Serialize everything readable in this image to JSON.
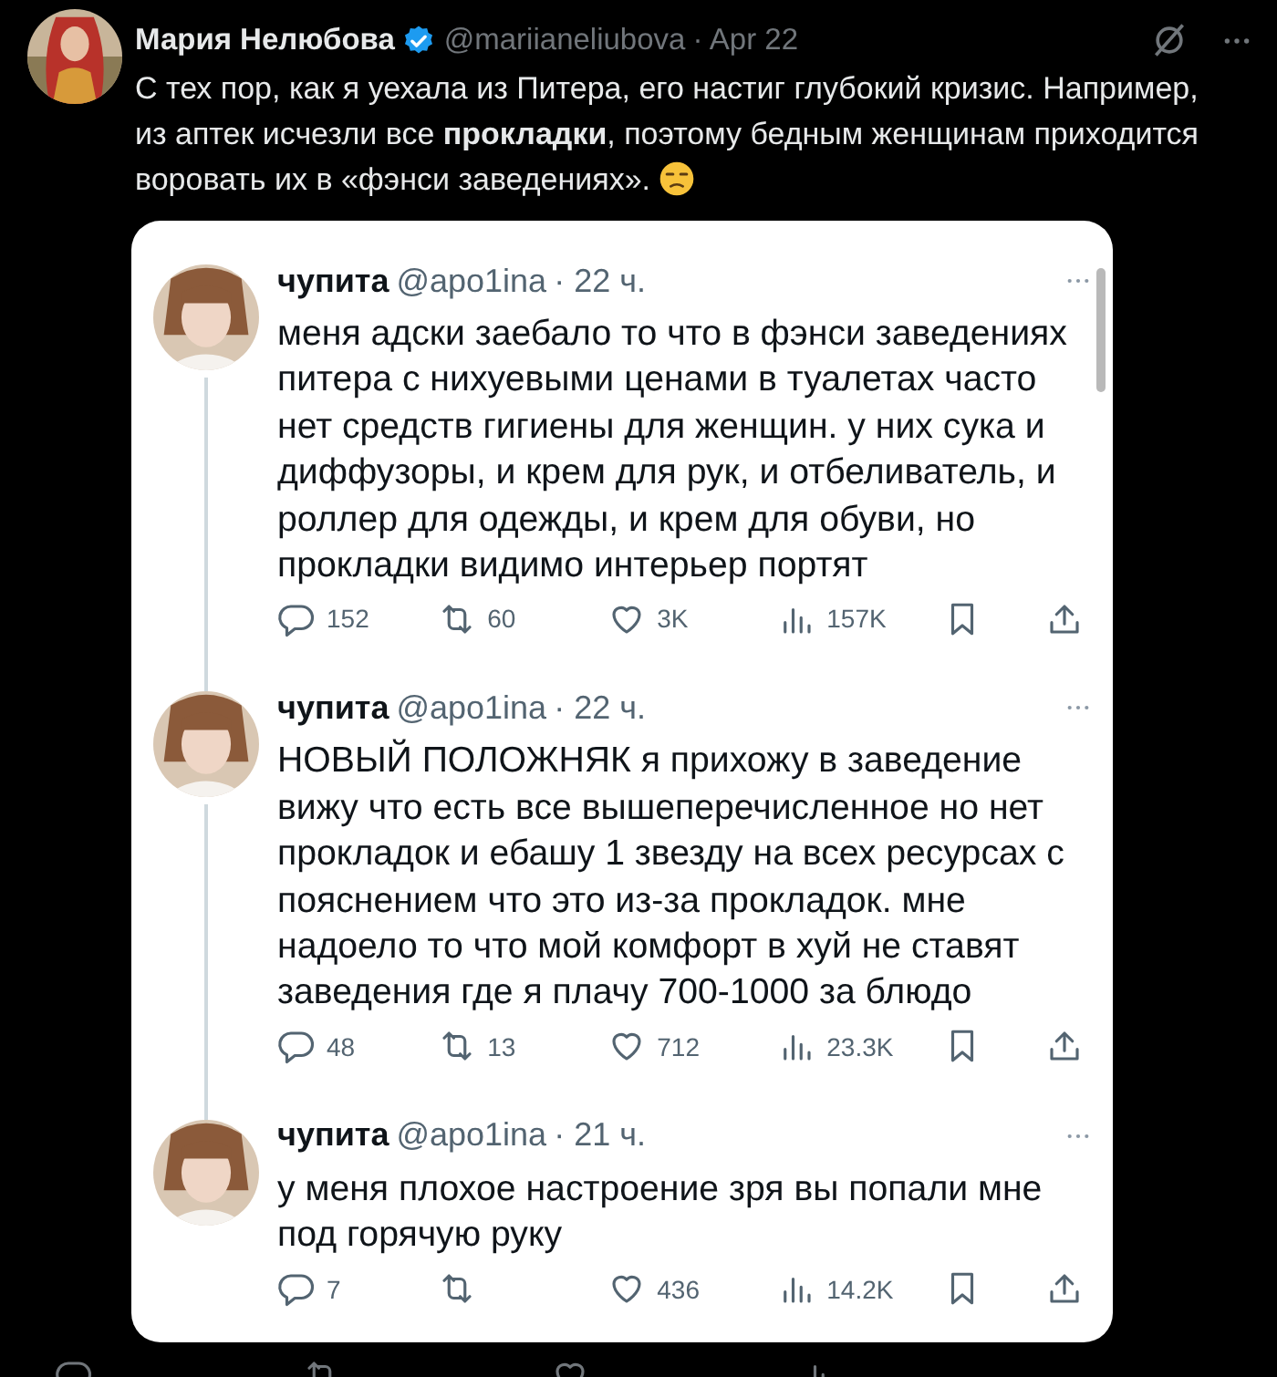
{
  "tweet": {
    "name": "Мария Нелюбова",
    "verified": true,
    "handle": "@mariianeliubova",
    "date": "· Apr 22",
    "text": "С тех пор, как я уехала из Питера, его настиг глубокий кризис. Например, из аптек исчезли все **прокладки**, поэтому бедным женщинам приходится воровать их в «фэнси заведениях».",
    "actions": [
      {
        "kind": "reply"
      },
      {
        "kind": "repost"
      },
      {
        "kind": "like"
      },
      {
        "kind": "views"
      }
    ]
  },
  "quoted_thread": [
    {
      "name": "чупита",
      "handle": "@apo1ina",
      "time": "· 22 ч.",
      "text": "меня адски заебало то что в фэнси заведениях питера с нихуевыми ценами в туалетах часто нет средств гигиены для женщин. у них сука и диффузоры, и крем для рук, и отбеливатель, и роллер для одежды, и крем для обуви, но прокладки видимо интерьер портят",
      "actions": [
        {
          "kind": "reply",
          "count": "152"
        },
        {
          "kind": "repost",
          "count": "60"
        },
        {
          "kind": "like",
          "count": "3K"
        },
        {
          "kind": "views",
          "count": "157K"
        },
        {
          "kind": "bookmark"
        },
        {
          "kind": "share"
        }
      ]
    },
    {
      "name": "чупита",
      "handle": "@apo1ina",
      "time": "· 22 ч.",
      "text": "НОВЫЙ ПОЛОЖНЯК я прихожу в заведение вижу что есть все вышеперечисленное но нет прокладок и ебашу 1 звезду на всех ресурсах с пояснением что это из-за прокладок. мне надоело то что мой комфорт в хуй не ставят заведения где я плачу 700-1000 за блюдо",
      "actions": [
        {
          "kind": "reply",
          "count": "48"
        },
        {
          "kind": "repost",
          "count": "13"
        },
        {
          "kind": "like",
          "count": "712"
        },
        {
          "kind": "views",
          "count": "23.3K"
        },
        {
          "kind": "bookmark"
        },
        {
          "kind": "share"
        }
      ]
    },
    {
      "name": "чупита",
      "handle": "@apo1ina",
      "time": "· 21 ч.",
      "text": "у меня плохое настроение зря вы попали мне под горячую руку",
      "actions": [
        {
          "kind": "reply",
          "count": "7"
        },
        {
          "kind": "repost"
        },
        {
          "kind": "like",
          "count": "436"
        },
        {
          "kind": "views",
          "count": "14.2K"
        },
        {
          "kind": "bookmark"
        },
        {
          "kind": "share"
        }
      ]
    }
  ]
}
